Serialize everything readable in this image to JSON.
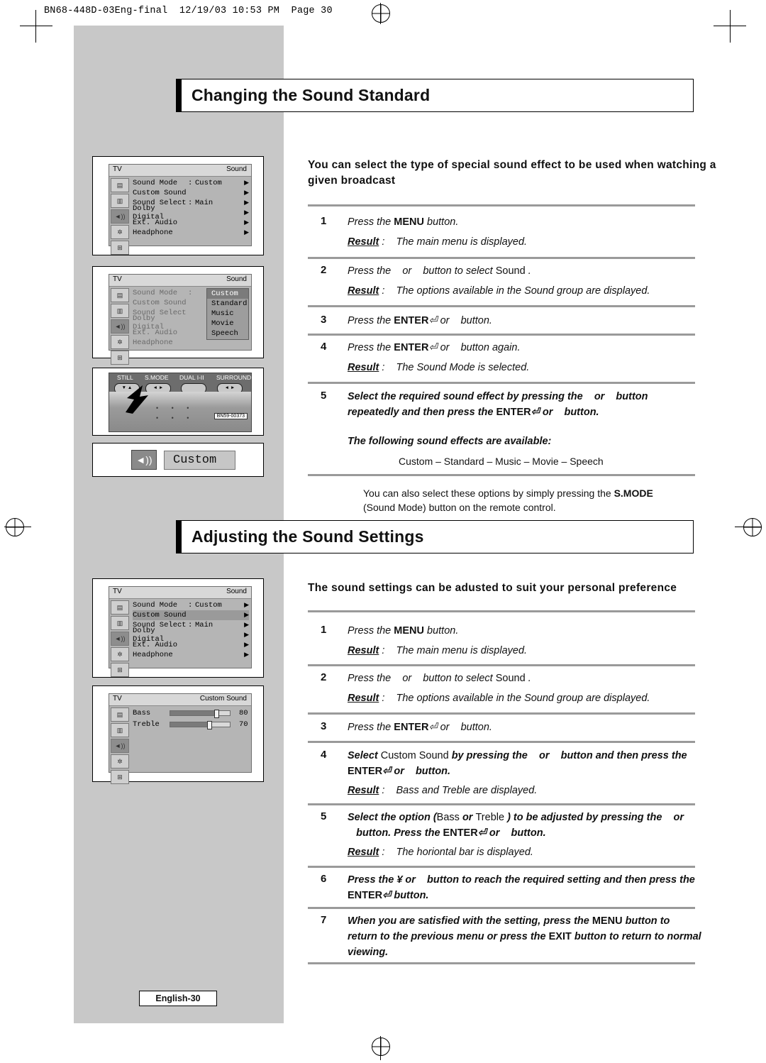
{
  "print_header": "BN68-448D-03Eng-final  12/19/03 10:53 PM  Page 30",
  "page_badge": "English-30",
  "sections": [
    {
      "title": "Changing the Sound Standard",
      "lead": "You can select the type of special sound effect to be used when watching a given broadcast",
      "steps": [
        {
          "num": "1",
          "lines": [
            "Press the  MENU  button."
          ],
          "result_label": "Result",
          "result": "The main menu is displayed."
        },
        {
          "num": "2",
          "lines": [
            "Press the      or     button to select Sound ."
          ],
          "result_label": "Result",
          "result": "The options available in the Sound group are displayed."
        },
        {
          "num": "3",
          "lines": [
            "Press the  ENTER    or     button."
          ],
          "result_label": "",
          "result": ""
        },
        {
          "num": "4",
          "lines": [
            "Press the  ENTER    or     button again."
          ],
          "result_label": "Result",
          "result": "The Sound Mode is selected."
        },
        {
          "num": "5",
          "lines": [
            "Select the required sound effect by pressing the      or     button repeatedly and then press the  ENTER    or     button.",
            "The following sound effects are available:"
          ],
          "result_label": "",
          "result": ""
        }
      ],
      "effects": "Custom  – Standard   – Music   – Movie   – Speech",
      "note_line1_a": "You can also select these options by simply pressing the ",
      "note_smode": "S.MODE",
      "note_line2": "(Sound Mode) button on the remote control."
    },
    {
      "title": "Adjusting the Sound Settings",
      "lead": "The sound settings can be adusted to suit your personal preference",
      "steps": [
        {
          "num": "1",
          "lines": [
            "Press the  MENU  button."
          ],
          "result_label": "Result",
          "result": "The main menu is displayed."
        },
        {
          "num": "2",
          "lines": [
            "Press the      or     button to select Sound ."
          ],
          "result_label": "Result",
          "result": "The options available in the Sound group are displayed."
        },
        {
          "num": "3",
          "lines": [
            "Press the  ENTER    or     button."
          ],
          "result_label": "",
          "result": ""
        },
        {
          "num": "4",
          "lines": [
            "Select Custom Sound  by pressing the      or     button and then press the ENTER    or     button."
          ],
          "result_label": "Result",
          "result": "Bass and Treble  are displayed."
        },
        {
          "num": "5",
          "lines": [
            "Select the option (Bass  or Treble  ) to be adjusted by pressing the      or     button. Press the  ENTER    or     button."
          ],
          "result_label": "Result",
          "result": "The horiontal  bar is displayed."
        },
        {
          "num": "6",
          "lines": [
            "Press the    or     button to reach the required setting and then press the  ENTER    button."
          ],
          "result_label": "",
          "result": ""
        },
        {
          "num": "7",
          "lines": [
            "When you are satisfied with the setting, press the  MENU  button to return to the previous menu or press the  EXIT  button to return to normal viewing."
          ],
          "result_label": "",
          "result": ""
        }
      ]
    }
  ],
  "osd_panels": [
    {
      "id": "sound-menu-1",
      "tv_label": "TV",
      "title": "Sound",
      "rows": [
        {
          "label": "Sound Mode",
          "colon": ":",
          "value": "Custom",
          "arrow": "▶",
          "state": "normal"
        },
        {
          "label": "Custom Sound",
          "colon": "",
          "value": "",
          "arrow": "▶",
          "state": "normal"
        },
        {
          "label": "Sound Select",
          "colon": ":",
          "value": "Main",
          "arrow": "▶",
          "state": "normal"
        },
        {
          "label": "Dolby Digital",
          "colon": "",
          "value": "",
          "arrow": "▶",
          "state": "normal"
        },
        {
          "label": "Ext. Audio",
          "colon": "",
          "value": "",
          "arrow": "▶",
          "state": "normal"
        },
        {
          "label": "Headphone",
          "colon": "",
          "value": "",
          "arrow": "▶",
          "state": "normal"
        }
      ],
      "submenu": []
    },
    {
      "id": "sound-menu-2",
      "tv_label": "TV",
      "title": "Sound",
      "rows": [
        {
          "label": "Sound Mode",
          "colon": ":",
          "value": "Custom",
          "arrow": "",
          "state": "dim-hl"
        },
        {
          "label": "Custom Sound",
          "colon": "",
          "value": "",
          "arrow": "",
          "state": "dim"
        },
        {
          "label": "Sound Select",
          "colon": ":",
          "value": "Main",
          "arrow": "",
          "state": "dim"
        },
        {
          "label": "Dolby Digital",
          "colon": "",
          "value": "",
          "arrow": "",
          "state": "dim"
        },
        {
          "label": "Ext. Audio",
          "colon": "",
          "value": "",
          "arrow": "",
          "state": "dim"
        },
        {
          "label": "Headphone",
          "colon": "",
          "value": "",
          "arrow": "",
          "state": "dim"
        }
      ],
      "submenu": [
        "Custom",
        "Standard",
        "Music",
        "Movie",
        "Speech"
      ],
      "submenu_selected": "Custom"
    },
    {
      "id": "sound-menu-3",
      "tv_label": "TV",
      "title": "Sound",
      "rows": [
        {
          "label": "Sound Mode",
          "colon": ":",
          "value": "Custom",
          "arrow": "▶",
          "state": "normal"
        },
        {
          "label": "Custom Sound",
          "colon": "",
          "value": "",
          "arrow": "▶",
          "state": "hl"
        },
        {
          "label": "Sound Select",
          "colon": ":",
          "value": "Main",
          "arrow": "▶",
          "state": "normal"
        },
        {
          "label": "Dolby Digital",
          "colon": "",
          "value": "",
          "arrow": "▶",
          "state": "normal"
        },
        {
          "label": "Ext. Audio",
          "colon": "",
          "value": "",
          "arrow": "▶",
          "state": "normal"
        },
        {
          "label": "Headphone",
          "colon": "",
          "value": "",
          "arrow": "▶",
          "state": "normal"
        }
      ],
      "submenu": []
    }
  ],
  "custom_sound_panel": {
    "tv_label": "TV",
    "title": "Custom Sound",
    "items": [
      {
        "label": "Bass",
        "value": "80"
      },
      {
        "label": "Treble",
        "value": "70"
      }
    ]
  },
  "remote": {
    "buttons": [
      "STILL",
      "S.MODE",
      "DUAL I-II",
      "SURROUND"
    ],
    "model": "BN59-00373"
  },
  "custom_indicator": {
    "label": "Custom",
    "icon": "speaker-icon"
  },
  "icons": {
    "picture": "picture-icon",
    "sound": "sound-icon",
    "channel": "channel-icon",
    "setup": "setup-icon",
    "pip": "pip-icon",
    "input": "input-icon"
  }
}
